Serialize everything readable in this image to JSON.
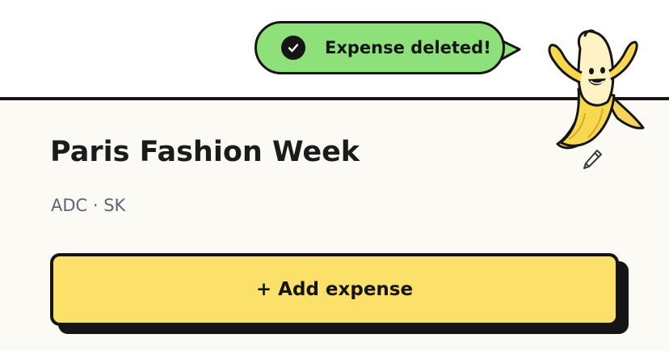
{
  "toast": {
    "message": "Expense deleted!",
    "icon": "check-circle-icon",
    "color": "#8ee07a"
  },
  "mascot": {
    "icon": "banana-mascot"
  },
  "trip": {
    "title": "Paris Fashion Week",
    "members": "ADC · SK",
    "edit_icon": "pencil-icon"
  },
  "actions": {
    "add_expense_label": "+ Add expense",
    "add_expense_color": "#fbe06a"
  },
  "colors": {
    "ink": "#151515",
    "panel_background": "#fbfaf4",
    "muted_text": "#5f6473"
  }
}
